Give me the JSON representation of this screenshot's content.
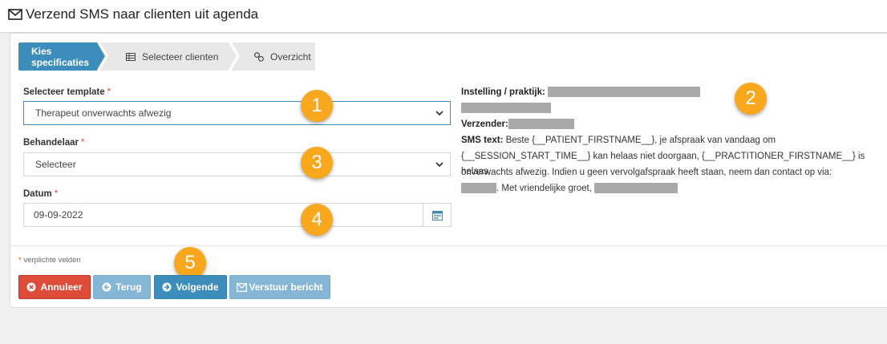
{
  "header": {
    "title": "Verzend SMS naar clienten uit agenda"
  },
  "wizard": {
    "steps": [
      {
        "label": "Kies specificaties",
        "active": true
      },
      {
        "label": "Selecteer clienten",
        "active": false
      },
      {
        "label": "Overzicht",
        "active": false
      }
    ]
  },
  "form": {
    "template": {
      "label": "Selecteer template",
      "required_mark": "*",
      "value": "Therapeut onverwachts afwezig"
    },
    "practitioner": {
      "label": "Behandelaar",
      "required_mark": "*",
      "value": "Selecteer"
    },
    "date": {
      "label": "Datum",
      "required_mark": "*",
      "value": "09-09-2022"
    }
  },
  "info": {
    "institution_label": "Instelling / praktijk:",
    "sender_label": "Verzender:",
    "sms_label": "SMS text:",
    "sms_line1": "Beste {__PATIENT_FIRSTNAME__}, je afspraak van vandaag om",
    "sms_line2": "{__SESSION_START_TIME__} kan helaas niet doorgaan, {__PRACTITIONER_FIRSTNAME__} is helaas",
    "sms_line3": "onverwachts afwezig. Indien u geen vervolgafspraak heeft staan, neem dan contact op via:",
    "sms_line4": ". Met vriendelijke groet,"
  },
  "badges": [
    "1",
    "2",
    "3",
    "4",
    "5"
  ],
  "footer": {
    "required_note_mark": "*",
    "required_note": "verplichte velden",
    "buttons": {
      "cancel": "Annuleer",
      "back": "Terug",
      "next": "Volgende",
      "send": "Verstuur bericht"
    }
  },
  "colors": {
    "primary": "#3c8dbc",
    "danger": "#dd4b39",
    "disabled_primary": "#86b6d6",
    "badge": "#f9a71c"
  }
}
